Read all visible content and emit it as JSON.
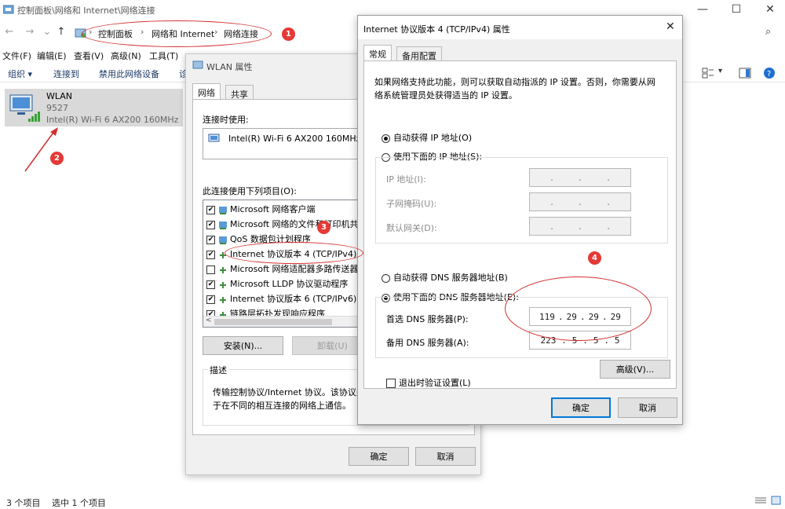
{
  "explorer": {
    "title": "控制面板\\网络和 Internet\\网络连接",
    "breadcrumbs": [
      "控制面板",
      "网络和 Internet",
      "网络连接"
    ],
    "menu": [
      "文件(F)",
      "编辑(E)",
      "查看(V)",
      "高级(N)",
      "工具(T)"
    ],
    "toolbar": [
      "组织 ▾",
      "连接到",
      "禁用此网络设备",
      "诊"
    ],
    "adapter": {
      "name": "WLAN",
      "ssid": "9527",
      "device": "Intel(R) Wi-Fi 6 AX200 160MHz"
    },
    "status": {
      "items": "3 个项目",
      "selected": "选中 1 个项目"
    }
  },
  "wlan_dialog": {
    "title": "WLAN 属性",
    "tabs": [
      "网络",
      "共享"
    ],
    "connect_using_label": "连接时使用:",
    "connect_using_device": "Intel(R) Wi-Fi 6 AX200 160MHz",
    "items_label": "此连接使用下列项目(O):",
    "items": [
      {
        "label": "Microsoft 网络客户端",
        "checked": "✔"
      },
      {
        "label": "Microsoft 网络的文件和打印机共",
        "checked": "✔"
      },
      {
        "label": "QoS 数据包计划程序",
        "checked": "✔"
      },
      {
        "label": "Internet 协议版本 4 (TCP/IPv4)",
        "checked": "✔"
      },
      {
        "label": "Microsoft 网络适配器多路传送器",
        "checked": ""
      },
      {
        "label": "Microsoft LLDP 协议驱动程序",
        "checked": "✔"
      },
      {
        "label": "Internet 协议版本 6 (TCP/IPv6)",
        "checked": "✔"
      },
      {
        "label": "链路层拓扑发现响应程序",
        "checked": "✔"
      }
    ],
    "install_button": "安装(N)...",
    "uninstall_button": "卸载(U)",
    "description_label": "描述",
    "description_text_1": "传输控制协议/Internet 协议。该协议是",
    "description_text_2": "于在不同的相互连接的网络上通信。",
    "ok_button": "确定",
    "cancel_button": "取消"
  },
  "ipv4_dialog": {
    "title": "Internet 协议版本 4 (TCP/IPv4) 属性",
    "tabs": [
      "常规",
      "备用配置"
    ],
    "intro_1": "如果网络支持此功能，则可以获取自动指派的 IP 设置。否则，你需要从网",
    "intro_2": "络系统管理员处获得适当的 IP 设置。",
    "auto_ip": "自动获得 IP 地址(O)",
    "manual_ip": "使用下面的 IP 地址(S):",
    "ip_address_label": "IP 地址(I):",
    "subnet_label": "子网掩码(U):",
    "gateway_label": "默认网关(D):",
    "auto_dns": "自动获得 DNS 服务器地址(B)",
    "manual_dns": "使用下面的 DNS 服务器地址(E):",
    "preferred_dns_label": "首选 DNS 服务器(P):",
    "alternate_dns_label": "备用 DNS 服务器(A):",
    "preferred_dns": [
      "119",
      "29",
      "29",
      "29"
    ],
    "alternate_dns": [
      "223",
      "5",
      "5",
      "5"
    ],
    "validate_on_exit": "退出时验证设置(L)",
    "advanced_button": "高级(V)...",
    "ok_button": "确定",
    "cancel_button": "取消"
  },
  "annotations": [
    "1",
    "2",
    "3",
    "4"
  ],
  "colors": {
    "accent": "#0078d7",
    "annotation": "#e53935",
    "selected_tile": "#d9d9d9"
  }
}
